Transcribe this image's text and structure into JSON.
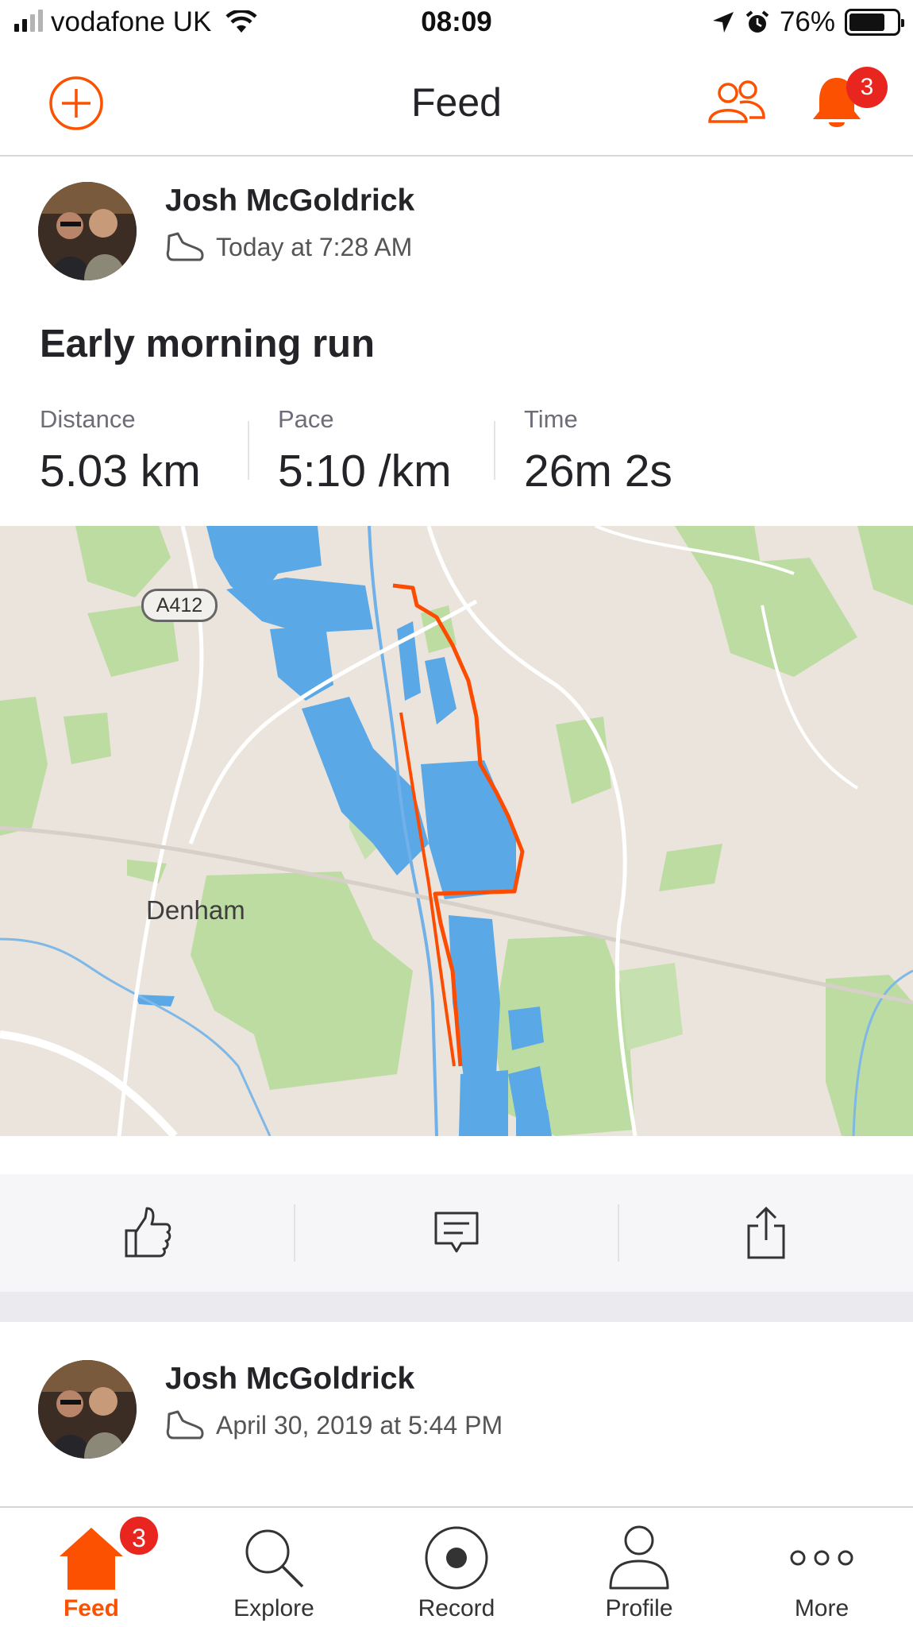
{
  "status_bar": {
    "carrier": "vodafone UK",
    "time": "08:09",
    "battery_percent": "76%",
    "battery_level": 0.76,
    "signal_bars_filled": 2
  },
  "nav": {
    "title": "Feed",
    "notification_count": "3",
    "accent_color": "#fc5200"
  },
  "feed": [
    {
      "athlete": "Josh McGoldrick",
      "timestamp": "Today at 7:28 AM",
      "title": "Early morning run",
      "stats": [
        {
          "label": "Distance",
          "value": "5.03 km"
        },
        {
          "label": "Pace",
          "value": "5:10 /km"
        },
        {
          "label": "Time",
          "value": "26m 2s"
        }
      ],
      "map": {
        "road_label": "A412",
        "town_label": "Denham"
      }
    },
    {
      "athlete": "Josh McGoldrick",
      "timestamp": "April 30, 2019 at 5:44 PM"
    }
  ],
  "tabbar": {
    "items": [
      {
        "label": "Feed",
        "icon": "home-icon",
        "active": true,
        "badge": "3"
      },
      {
        "label": "Explore",
        "icon": "search-icon"
      },
      {
        "label": "Record",
        "icon": "record-icon"
      },
      {
        "label": "Profile",
        "icon": "profile-icon"
      },
      {
        "label": "More",
        "icon": "more-icon"
      }
    ]
  }
}
